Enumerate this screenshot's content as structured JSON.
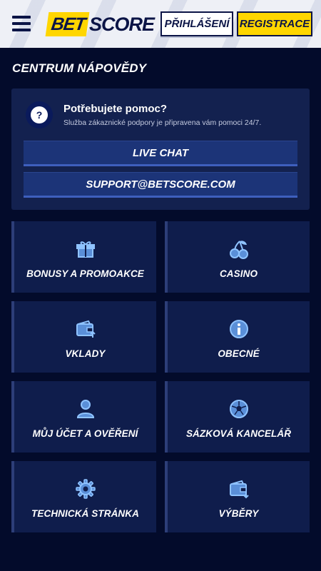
{
  "header": {
    "logo_bet": "BET",
    "logo_score": "SCORE",
    "login_label": "PŘIHLÁŠENÍ",
    "register_label": "REGISTRACE"
  },
  "page_title": "CENTRUM NÁPOVĚDY",
  "help": {
    "icon_glyph": "?",
    "title": "Potřebujete pomoc?",
    "subtitle": "Služba zákaznické podpory je připravena vám pomoci 24/7.",
    "chat_label": "LIVE CHAT",
    "email_label": "SUPPORT@BETSCORE.COM"
  },
  "categories": [
    {
      "label": "BONUSY A PROMOAKCE",
      "icon": "gift-icon"
    },
    {
      "label": "CASINO",
      "icon": "cherries-icon"
    },
    {
      "label": "VKLADY",
      "icon": "wallet-deposit-icon"
    },
    {
      "label": "OBECNÉ",
      "icon": "info-icon"
    },
    {
      "label": "MŮJ ÚČET A OVĚŘENÍ",
      "icon": "user-icon"
    },
    {
      "label": "SÁZKOVÁ KANCELÁŘ",
      "icon": "football-icon"
    },
    {
      "label": "TECHNICKÁ STRÁNKA",
      "icon": "gear-icon"
    },
    {
      "label": "VÝBĚRY",
      "icon": "wallet-withdraw-icon"
    }
  ],
  "colors": {
    "background": "#030b2b",
    "card": "#13214f",
    "tile": "#0f1d4c",
    "accent_yellow": "#ffd600",
    "icon_blue": "#8fc3ff"
  }
}
